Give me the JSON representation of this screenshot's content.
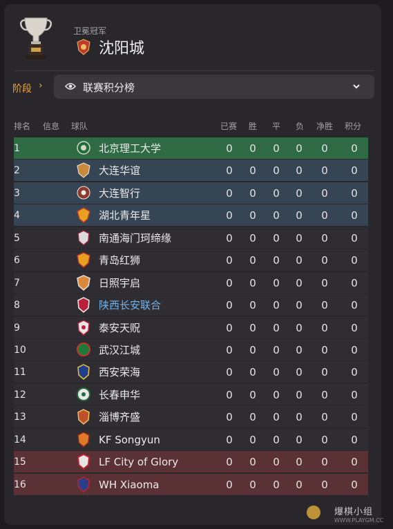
{
  "header": {
    "subtitle": "卫冕冠军",
    "title": "沈阳城"
  },
  "stage": {
    "label": "阶段",
    "dropdown_value": "联赛积分榜"
  },
  "columns": {
    "pos": "排名",
    "info": "信息",
    "team": "球队",
    "played": "已赛",
    "won": "胜",
    "drawn": "平",
    "lost": "负",
    "gd": "净胜",
    "pts": "积分"
  },
  "rows": [
    {
      "pos": "1",
      "team": "北京理工大学",
      "played": "0",
      "won": "0",
      "drawn": "0",
      "lost": "0",
      "gd": "0",
      "pts": "0"
    },
    {
      "pos": "2",
      "team": "大连华谊",
      "played": "0",
      "won": "0",
      "drawn": "0",
      "lost": "0",
      "gd": "0",
      "pts": "0"
    },
    {
      "pos": "3",
      "team": "大连智行",
      "played": "0",
      "won": "0",
      "drawn": "0",
      "lost": "0",
      "gd": "0",
      "pts": "0"
    },
    {
      "pos": "4",
      "team": "湖北青年星",
      "played": "0",
      "won": "0",
      "drawn": "0",
      "lost": "0",
      "gd": "0",
      "pts": "0"
    },
    {
      "pos": "5",
      "team": "南通海门珂缔缘",
      "played": "0",
      "won": "0",
      "drawn": "0",
      "lost": "0",
      "gd": "0",
      "pts": "0"
    },
    {
      "pos": "6",
      "team": "青岛红狮",
      "played": "0",
      "won": "0",
      "drawn": "0",
      "lost": "0",
      "gd": "0",
      "pts": "0"
    },
    {
      "pos": "7",
      "team": "日照宇启",
      "played": "0",
      "won": "0",
      "drawn": "0",
      "lost": "0",
      "gd": "0",
      "pts": "0"
    },
    {
      "pos": "8",
      "team": "陕西长安联合",
      "played": "0",
      "won": "0",
      "drawn": "0",
      "lost": "0",
      "gd": "0",
      "pts": "0"
    },
    {
      "pos": "9",
      "team": "泰安天贶",
      "played": "0",
      "won": "0",
      "drawn": "0",
      "lost": "0",
      "gd": "0",
      "pts": "0"
    },
    {
      "pos": "10",
      "team": "武汉江城",
      "played": "0",
      "won": "0",
      "drawn": "0",
      "lost": "0",
      "gd": "0",
      "pts": "0"
    },
    {
      "pos": "11",
      "team": "西安荣海",
      "played": "0",
      "won": "0",
      "drawn": "0",
      "lost": "0",
      "gd": "0",
      "pts": "0"
    },
    {
      "pos": "12",
      "team": "长春申华",
      "played": "0",
      "won": "0",
      "drawn": "0",
      "lost": "0",
      "gd": "0",
      "pts": "0"
    },
    {
      "pos": "13",
      "team": "淄博齐盛",
      "played": "0",
      "won": "0",
      "drawn": "0",
      "lost": "0",
      "gd": "0",
      "pts": "0"
    },
    {
      "pos": "14",
      "team": "KF Songyun",
      "played": "0",
      "won": "0",
      "drawn": "0",
      "lost": "0",
      "gd": "0",
      "pts": "0"
    },
    {
      "pos": "15",
      "team": "LF City of Glory",
      "played": "0",
      "won": "0",
      "drawn": "0",
      "lost": "0",
      "gd": "0",
      "pts": "0"
    },
    {
      "pos": "16",
      "team": "WH Xiaoma",
      "played": "0",
      "won": "0",
      "drawn": "0",
      "lost": "0",
      "gd": "0",
      "pts": "0"
    }
  ],
  "watermark": {
    "text": "爆棋小组",
    "url": "WWW.PLAYGM.CC"
  },
  "colors": {
    "accent": "#f0a437",
    "champion_row": "#2e6a44",
    "promotion_row": "#354553",
    "relegation_row": "#5a3236",
    "link": "#6fb3f0"
  },
  "icons": {
    "trophy": "trophy-icon",
    "view": "eye-icon",
    "expand": "chevron-down-icon",
    "stage_arrow": "chevron-right-icon"
  }
}
